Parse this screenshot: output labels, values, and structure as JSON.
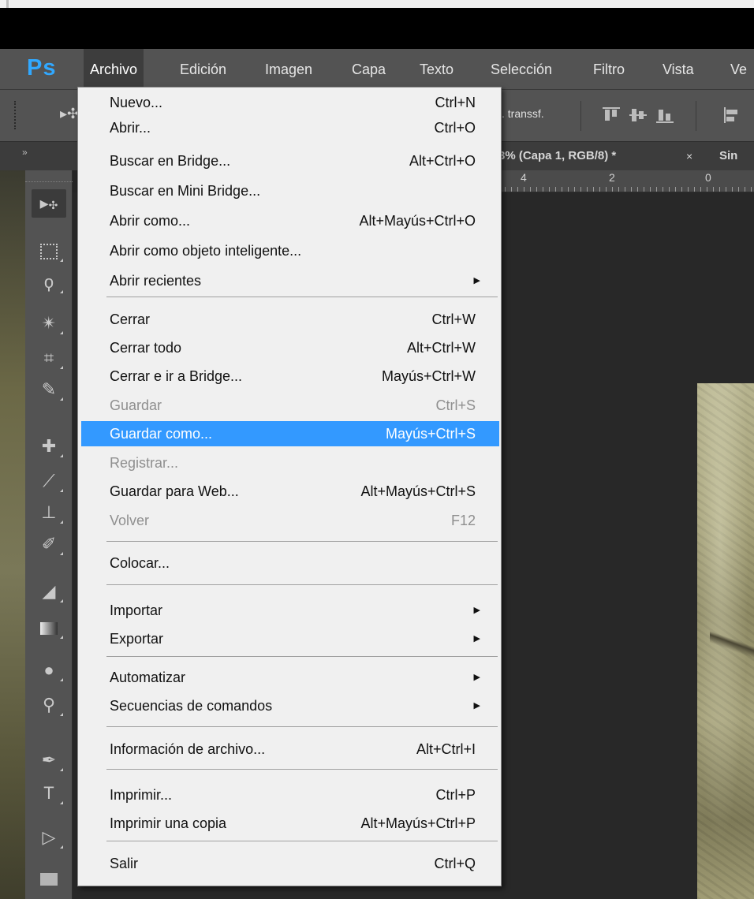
{
  "app": {
    "logo": "Ps"
  },
  "menubar": {
    "items": [
      "Archivo",
      "Edición",
      "Imagen",
      "Capa",
      "Texto",
      "Selección",
      "Filtro",
      "Vista",
      "Ve"
    ],
    "active": "Archivo"
  },
  "options_bar": {
    "transform_label": ". transsf."
  },
  "document_tabs": [
    {
      "label": "3% (Capa 1, RGB/8) *",
      "close": "×"
    },
    {
      "label": "Sin"
    }
  ],
  "ruler": {
    "labels": [
      "4",
      "2",
      "0"
    ]
  },
  "file_menu": {
    "items": [
      {
        "label": "Nuevo...",
        "shortcut": "Ctrl+N"
      },
      {
        "label": "Abrir...",
        "shortcut": "Ctrl+O"
      },
      {
        "label": "Buscar en Bridge...",
        "shortcut": "Alt+Ctrl+O"
      },
      {
        "label": "Buscar en Mini Bridge...",
        "shortcut": ""
      },
      {
        "label": "Abrir como...",
        "shortcut": "Alt+Mayús+Ctrl+O"
      },
      {
        "label": "Abrir como objeto inteligente...",
        "shortcut": ""
      },
      {
        "label": "Abrir recientes",
        "shortcut": "",
        "submenu": true
      },
      {
        "label": "Cerrar",
        "shortcut": "Ctrl+W"
      },
      {
        "label": "Cerrar todo",
        "shortcut": "Alt+Ctrl+W"
      },
      {
        "label": "Cerrar e ir a Bridge...",
        "shortcut": "Mayús+Ctrl+W"
      },
      {
        "label": "Guardar",
        "shortcut": "Ctrl+S",
        "disabled": true
      },
      {
        "label": "Guardar como...",
        "shortcut": "Mayús+Ctrl+S",
        "highlighted": true
      },
      {
        "label": "Registrar...",
        "shortcut": "",
        "disabled": true
      },
      {
        "label": "Guardar para Web...",
        "shortcut": "Alt+Mayús+Ctrl+S"
      },
      {
        "label": "Volver",
        "shortcut": "F12",
        "disabled": true
      },
      {
        "label": "Colocar...",
        "shortcut": ""
      },
      {
        "label": "Importar",
        "shortcut": "",
        "submenu": true
      },
      {
        "label": "Exportar",
        "shortcut": "",
        "submenu": true
      },
      {
        "label": "Automatizar",
        "shortcut": "",
        "submenu": true
      },
      {
        "label": "Secuencias de comandos",
        "shortcut": "",
        "submenu": true
      },
      {
        "label": "Información de archivo...",
        "shortcut": "Alt+Ctrl+I"
      },
      {
        "label": "Imprimir...",
        "shortcut": "Ctrl+P"
      },
      {
        "label": "Imprimir una copia",
        "shortcut": "Alt+Mayús+Ctrl+P"
      },
      {
        "label": "Salir",
        "shortcut": "Ctrl+Q"
      }
    ],
    "highlight_color": "#3399ff"
  },
  "toolbox": {
    "tools": [
      "move-tool-icon",
      "marquee-tool-icon",
      "lasso-tool-icon",
      "magic-wand-tool-icon",
      "crop-tool-icon",
      "eyedropper-tool-icon",
      "healing-brush-tool-icon",
      "brush-tool-icon",
      "clone-stamp-tool-icon",
      "history-brush-tool-icon",
      "eraser-tool-icon",
      "gradient-tool-icon",
      "blur-tool-icon",
      "dodge-tool-icon",
      "pen-tool-icon",
      "type-tool-icon",
      "path-selection-tool-icon",
      "rectangle-tool-icon"
    ]
  }
}
